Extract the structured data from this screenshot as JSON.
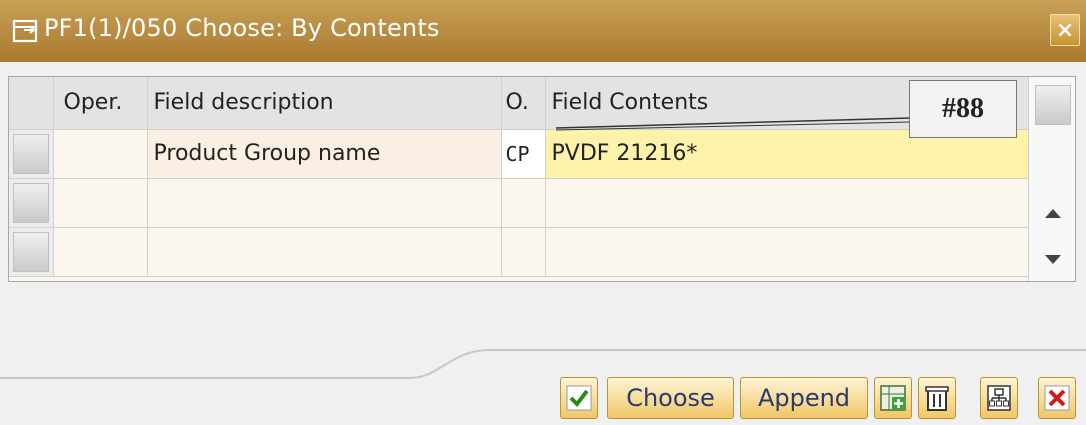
{
  "window": {
    "title": "PF1(1)/050 Choose: By Contents",
    "close_glyph": "×"
  },
  "table": {
    "headers": [
      "Oper.",
      "Field description",
      "O.",
      "Field Contents"
    ],
    "rows": [
      {
        "oper": "",
        "description": "Product Group name",
        "option": "CP",
        "contents": "PVDF 21216*"
      },
      {
        "oper": "",
        "description": "",
        "option": "",
        "contents": ""
      },
      {
        "oper": "",
        "description": "",
        "option": "",
        "contents": ""
      }
    ]
  },
  "annotation": {
    "label": "#88"
  },
  "buttons": {
    "confirm_icon": "check-icon",
    "choose": "Choose",
    "append": "Append",
    "insert_icon": "insert-row-icon",
    "delete_icon": "trash-icon",
    "options_icon": "hierarchy-icon",
    "cancel_icon": "cancel-icon"
  },
  "colors": {
    "titlebar": "#b88a3e",
    "highlight_field": "#fff2ab",
    "button_bg": "#f0c766",
    "cancel_red": "#d11a1a",
    "confirm_green": "#2e8b1a"
  }
}
